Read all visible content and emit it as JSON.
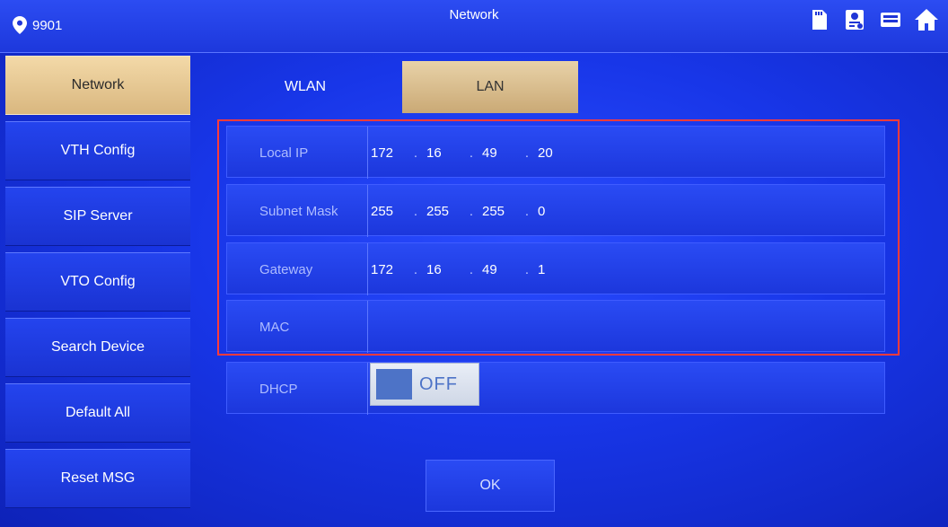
{
  "header": {
    "device_id": "9901",
    "title": "Network",
    "icons": [
      "sd-card-icon",
      "contact-icon",
      "screen-icon",
      "home-icon"
    ]
  },
  "sidebar": {
    "items": [
      {
        "label": "Network",
        "active": true
      },
      {
        "label": "VTH Config",
        "active": false
      },
      {
        "label": "SIP Server",
        "active": false
      },
      {
        "label": "VTO Config",
        "active": false
      },
      {
        "label": "Search Device",
        "active": false
      },
      {
        "label": "Default All",
        "active": false
      },
      {
        "label": "Reset MSG",
        "active": false
      }
    ]
  },
  "tabs": [
    {
      "label": "WLAN",
      "active": false
    },
    {
      "label": "LAN",
      "active": true
    }
  ],
  "form": {
    "local_ip": {
      "label": "Local IP",
      "octets": [
        "172",
        "16",
        "49",
        "20"
      ]
    },
    "subnet_mask": {
      "label": "Subnet Mask",
      "octets": [
        "255",
        "255",
        "255",
        "0"
      ]
    },
    "gateway": {
      "label": "Gateway",
      "octets": [
        "172",
        "16",
        "49",
        "1"
      ]
    },
    "mac": {
      "label": "MAC",
      "value": ""
    },
    "dhcp": {
      "label": "DHCP",
      "state": "OFF"
    }
  },
  "buttons": {
    "ok": "OK"
  },
  "colors": {
    "accent_active": "#d9b77f",
    "background": "#1836e8",
    "highlight_border": "#ff3b3b",
    "toggle_knob": "#4d73c7"
  }
}
